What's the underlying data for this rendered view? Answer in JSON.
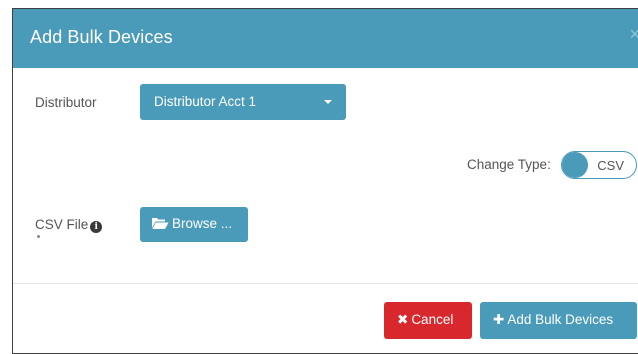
{
  "modal": {
    "title": "Add Bulk Devices",
    "close_glyph": "×"
  },
  "form": {
    "distributor_label": "Distributor",
    "distributor_value": "Distributor Acct 1",
    "change_type_label": "Change Type:",
    "change_type_value": "CSV",
    "csv_file_label": "CSV File",
    "info_glyph": "i",
    "browse_label": "Browse ..."
  },
  "footer": {
    "cancel_glyph": "✖",
    "cancel_label": "Cancel",
    "add_glyph": "✚",
    "add_label": "Add Bulk Devices"
  },
  "colors": {
    "accent": "#4a9bb9",
    "danger": "#d9272e"
  },
  "icons": {
    "close": "close-icon",
    "caret": "chevron-down-icon",
    "info": "info-icon",
    "folder": "folder-open-icon",
    "cancel": "times-icon",
    "add": "plus-icon"
  }
}
